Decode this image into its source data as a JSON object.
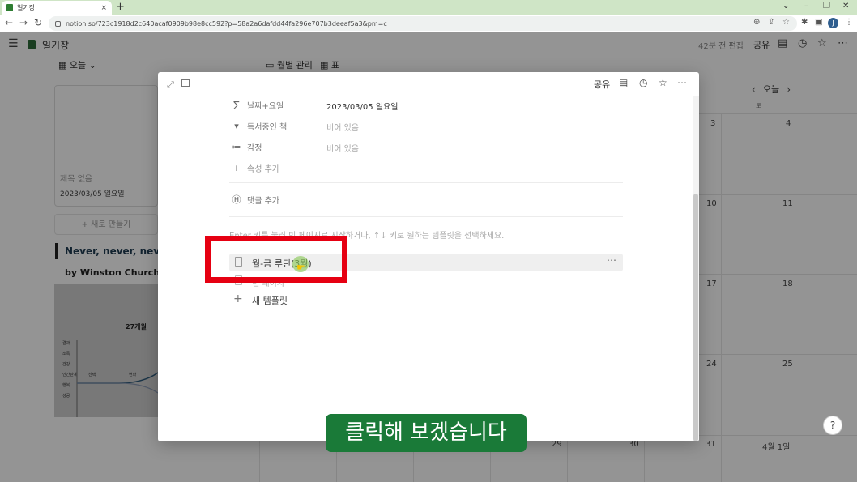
{
  "browser": {
    "tab_title": "일기장",
    "tab_close": "×",
    "new_tab": "+",
    "window_controls": [
      "⌄",
      "–",
      "❐",
      "✕"
    ],
    "url": "notion.so/723c1918d2c640acaf0909b98e8cc592?p=58a2a6dafdd44fa296e707b3deeaf5a3&pm=c",
    "avatar_letter": "J"
  },
  "page": {
    "title": "일기장",
    "edited": "42분 전 편집",
    "share": "공유",
    "view_today": "오늘",
    "view_monthly": "월별 관리",
    "view_table": "표",
    "card": {
      "title": "제목 없음",
      "date": "2023/03/05 일요일"
    },
    "new_button": "+ 새로 만들기",
    "quote": "Never, never, never",
    "author": "by Winston Churchill",
    "graph_title": "27개월",
    "graph_labels": [
      "결과",
      "소득",
      "건강",
      "인간관계",
      "행복",
      "성공"
    ],
    "graph_sub_labels": [
      "선택",
      "변화"
    ]
  },
  "calendar": {
    "today": "오늘",
    "sat_header": "토",
    "week_nums": [
      [
        "3",
        "4"
      ],
      [
        "10",
        "11"
      ],
      [
        "17",
        "18"
      ],
      [
        "24",
        "25"
      ]
    ],
    "bottom_nums": [
      "29",
      "30",
      "31",
      "4월 1일"
    ],
    "help": "?"
  },
  "modal": {
    "share": "공유",
    "properties": [
      {
        "icon": "∑",
        "label": "날짜+요일",
        "value": "2023/03/05 일요일",
        "empty": false
      },
      {
        "icon": "▾",
        "label": "독서중인 책",
        "value": "비어 있음",
        "empty": true
      },
      {
        "icon": "≔",
        "label": "감정",
        "value": "비어 있음",
        "empty": true
      }
    ],
    "add_property": "속성 추가",
    "add_comment": "댓글 추가",
    "hint": "Enter 키를 눌러 빈 페이지로 시작하거나, ↑↓ 키로 원하는 템플릿을 선택하세요.",
    "template_1": "월-금 루틴(3월)",
    "template_2": "빈 페이지",
    "new_template": "새 템플릿"
  },
  "subtitle": "클릭해 보겠습니다",
  "colors": {
    "highlight": "#e60012",
    "subtitle_bg": "#1a7a38",
    "tabbar": "#cfe5c6"
  }
}
